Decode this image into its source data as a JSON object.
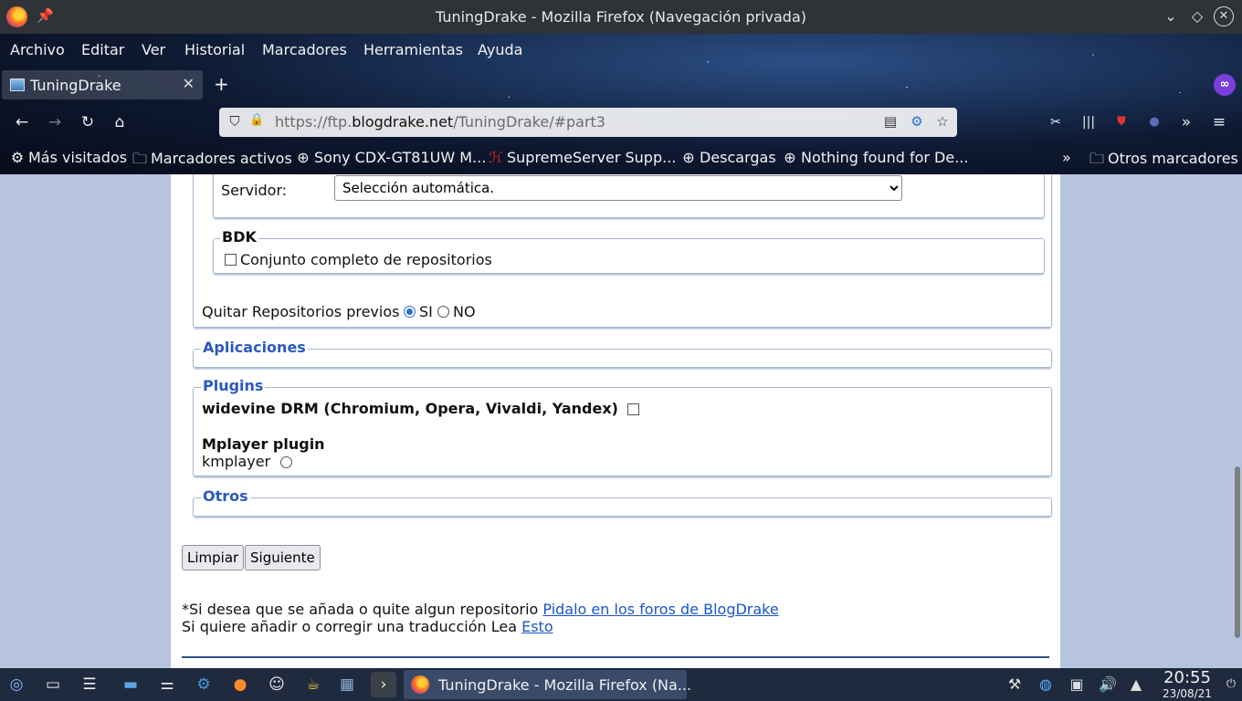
{
  "window": {
    "title": "TuningDrake - Mozilla Firefox (Navegación privada)"
  },
  "menubar": {
    "items": [
      "Archivo",
      "Editar",
      "Ver",
      "Historial",
      "Marcadores",
      "Herramientas",
      "Ayuda"
    ]
  },
  "tabs": [
    {
      "label": "TuningDrake"
    }
  ],
  "urlbar": {
    "prefix": "https://ftp.",
    "domain": "blogdrake.net",
    "path": "/TuningDrake/#part3"
  },
  "bookmarks": [
    {
      "label": "Más visitados",
      "icon": "gear-icon"
    },
    {
      "label": "Marcadores activos",
      "icon": "folder-icon"
    },
    {
      "label": "Sony CDX-GT81UW M...",
      "icon": "globe-icon"
    },
    {
      "label": "SupremeServer Supp...",
      "icon": "supremeserver-icon"
    },
    {
      "label": "Descargas",
      "icon": "globe-icon"
    },
    {
      "label": "Nothing found for De...",
      "icon": "globe-icon"
    },
    {
      "label": "Otros marcadores",
      "icon": "folder-icon"
    }
  ],
  "page": {
    "servidor": {
      "label": "Servidor:",
      "selected": "Selección automática."
    },
    "bdk": {
      "legend": "BDK",
      "checkbox_label": "Conjunto completo de repositorios"
    },
    "quitar": {
      "label": "Quitar Repositorios previos",
      "yes": "SI",
      "no": "NO",
      "selected": "SI"
    },
    "aplicaciones": {
      "legend": "Aplicaciones"
    },
    "plugins": {
      "legend": "Plugins",
      "widevine": "widevine DRM (Chromium, Opera, Vivaldi, Yandex)",
      "mplayer_title": "Mplayer plugin",
      "kmplayer": "kmplayer"
    },
    "otros": {
      "legend": "Otros"
    },
    "buttons": {
      "limpiar": "Limpiar",
      "siguiente": "Siguiente"
    },
    "footer": {
      "line1_text": "*Si desea que se añada o quite algun repositorio ",
      "line1_link": "Pidalo en los foros de BlogDrake",
      "line2_text": "Si quiere añadir o corregir una traducción Lea ",
      "line2_link": "Esto"
    }
  },
  "taskbar": {
    "active_window": "TuningDrake - Mozilla Firefox (Na...",
    "time": "20:55",
    "date": "23/08/21"
  }
}
